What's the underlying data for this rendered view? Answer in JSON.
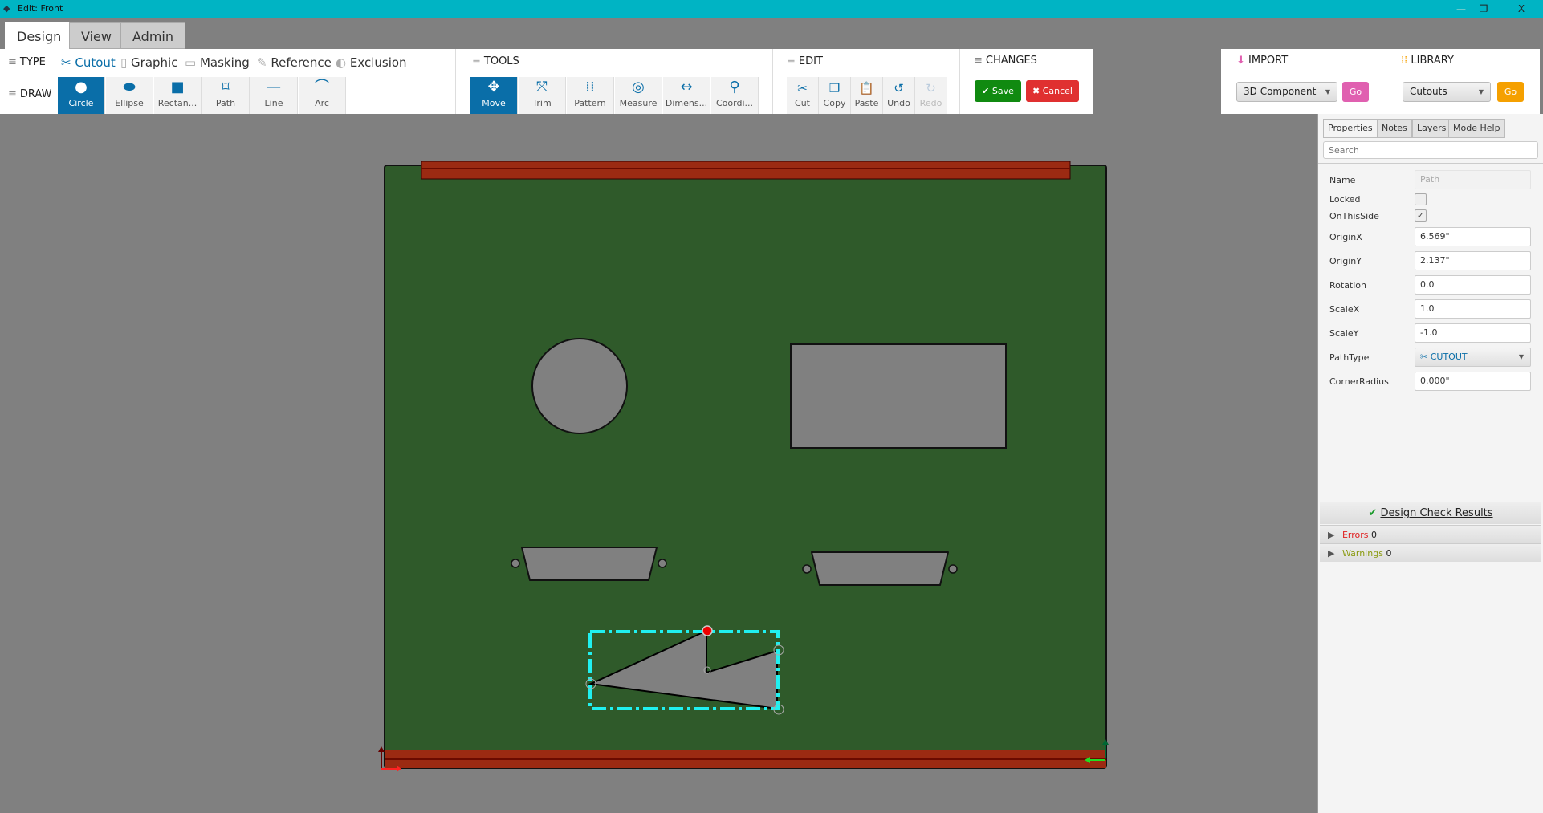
{
  "window": {
    "title": "Edit: Front",
    "minimize": "—",
    "restore": "❐",
    "close": "X"
  },
  "tabs": [
    "Design",
    "View",
    "Admin"
  ],
  "type_section": {
    "label": "TYPE",
    "items": [
      {
        "label": "Cutout",
        "icon": "scissors-icon"
      },
      {
        "label": "Graphic",
        "icon": "file-icon"
      },
      {
        "label": "Masking",
        "icon": "masking-icon"
      },
      {
        "label": "Reference",
        "icon": "edit-icon"
      },
      {
        "label": "Exclusion",
        "icon": "half-circle-icon"
      }
    ]
  },
  "draw_section": {
    "label": "DRAW",
    "buttons": [
      {
        "label": "Circle",
        "icon": "●"
      },
      {
        "label": "Ellipse",
        "icon": "⬬"
      },
      {
        "label": "Rectan...",
        "icon": "■"
      },
      {
        "label": "Path",
        "icon": "⌑"
      },
      {
        "label": "Line",
        "icon": "—"
      },
      {
        "label": "Arc",
        "icon": "⌒"
      }
    ]
  },
  "tools_section": {
    "label": "TOOLS",
    "buttons": [
      {
        "label": "Move",
        "icon": "✥"
      },
      {
        "label": "Trim",
        "icon": "⤧"
      },
      {
        "label": "Pattern",
        "icon": "⁞⁞"
      },
      {
        "label": "Measure",
        "icon": "◎"
      },
      {
        "label": "Dimens...",
        "icon": "↔"
      },
      {
        "label": "Coordi...",
        "icon": "⚲"
      }
    ]
  },
  "edit_section": {
    "label": "EDIT",
    "buttons": [
      {
        "label": "Cut",
        "icon": "✂"
      },
      {
        "label": "Copy",
        "icon": "❐"
      },
      {
        "label": "Paste",
        "icon": "📋"
      },
      {
        "label": "Undo",
        "icon": "↺"
      },
      {
        "label": "Redo",
        "icon": "↻"
      }
    ]
  },
  "changes_section": {
    "label": "CHANGES",
    "save": "✔ Save",
    "cancel": "✖ Cancel"
  },
  "import_section": {
    "label": "IMPORT",
    "selected": "3D Component",
    "go": "Go",
    "color": "#e060b0"
  },
  "library_section": {
    "label": "LIBRARY",
    "selected": "Cutouts",
    "go": "Go",
    "color": "#f5a000"
  },
  "colors": {
    "board": "#2f5a2a",
    "rail": "#9b2a12",
    "cutout": "#808080",
    "selection": "#20f0f0"
  },
  "right_panel": {
    "tabs": [
      "Properties",
      "Notes",
      "Layers",
      "Mode Help"
    ],
    "search_placeholder": "Search",
    "properties": {
      "name": {
        "label": "Name",
        "value": "Path"
      },
      "locked": {
        "label": "Locked",
        "checked": false
      },
      "on_this_side": {
        "label": "OnThisSide",
        "checked": true,
        "mark": "✓"
      },
      "origin_x": {
        "label": "OriginX",
        "value": "6.569\""
      },
      "origin_y": {
        "label": "OriginY",
        "value": "2.137\""
      },
      "rotation": {
        "label": "Rotation",
        "value": "0.0"
      },
      "scale_x": {
        "label": "ScaleX",
        "value": "1.0"
      },
      "scale_y": {
        "label": "ScaleY",
        "value": "-1.0"
      },
      "path_type": {
        "label": "PathType",
        "value": "✂ CUTOUT"
      },
      "corner_radius": {
        "label": "CornerRadius",
        "value": "0.000\""
      }
    },
    "design_check": {
      "title": "Design Check Results",
      "errors_label": "Errors",
      "errors": "0",
      "warnings_label": "Warnings",
      "warnings": "0"
    }
  }
}
